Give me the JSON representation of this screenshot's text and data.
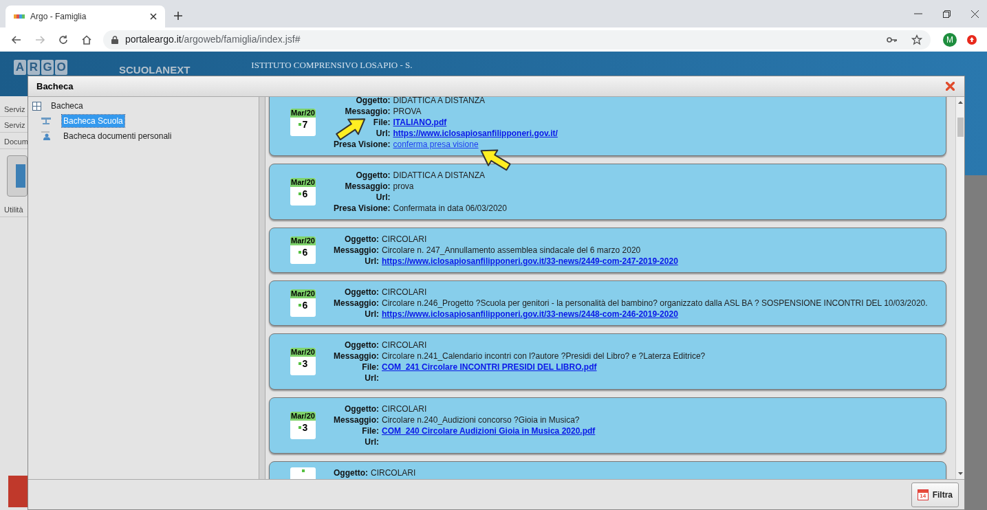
{
  "browser": {
    "tab_title": "Argo - Famiglia",
    "url_host": "portaleargo.it",
    "url_path": "/argoweb/famiglia/index.jsf#",
    "avatar": "M"
  },
  "app_header": {
    "logo_letters": [
      "A",
      "R",
      "G",
      "O"
    ],
    "product": "SCUOLANEXT",
    "school": "ISTITUTO COMPRENSIVO LOSAPIO - S."
  },
  "app_sidebar": {
    "items": [
      "Serviz",
      "Serviz",
      "Docum",
      "Utilità"
    ]
  },
  "dialog": {
    "title": "Bacheca",
    "tree": {
      "label": "Bacheca",
      "children": [
        {
          "label": "Bacheca Scuola",
          "selected": true
        },
        {
          "label": "Bacheca documenti personali",
          "selected": false
        }
      ]
    },
    "notices": [
      {
        "month": "Mar/20",
        "day": "7",
        "fields": [
          {
            "label": "Oggetto:",
            "value": "DIDATTICA A DISTANZA",
            "kind": "text"
          },
          {
            "label": "Messaggio:",
            "value": "PROVA",
            "kind": "text"
          },
          {
            "label": "File:",
            "value": "ITALIANO.pdf",
            "kind": "link"
          },
          {
            "label": "Url:",
            "value": "https://www.iclosapiosanfilipponeri.gov.it/",
            "kind": "link"
          },
          {
            "label": "Presa Visione:",
            "value": "conferma presa visione",
            "kind": "action"
          }
        ]
      },
      {
        "month": "Mar/20",
        "day": "6",
        "fields": [
          {
            "label": "Oggetto:",
            "value": "DIDATTICA A DISTANZA",
            "kind": "text"
          },
          {
            "label": "Messaggio:",
            "value": "prova",
            "kind": "text"
          },
          {
            "label": "Url:"
          },
          {
            "label": "Presa Visione:",
            "value": "Confermata in data 06/03/2020",
            "kind": "text"
          }
        ]
      },
      {
        "month": "Mar/20",
        "day": "6",
        "fields": [
          {
            "label": "Oggetto:",
            "value": "CIRCOLARI",
            "kind": "text"
          },
          {
            "label": "Messaggio:",
            "value": "Circolare n. 247_Annullamento assemblea sindacale del 6 marzo 2020",
            "kind": "text"
          },
          {
            "label": "Url:",
            "value": "https://www.iclosapiosanfilipponeri.gov.it/33-news/2449-com-247-2019-2020",
            "kind": "link"
          }
        ]
      },
      {
        "month": "Mar/20",
        "day": "6",
        "fields": [
          {
            "label": "Oggetto:",
            "value": "CIRCOLARI",
            "kind": "text"
          },
          {
            "label": "Messaggio:",
            "value": "Circolare n.246_Progetto ?Scuola per genitori - la personalità del bambino? organizzato dalla ASL BA ? SOSPENSIONE INCONTRI DEL 10/03/2020.",
            "kind": "text"
          },
          {
            "label": "Url:",
            "value": "https://www.iclosapiosanfilipponeri.gov.it/33-news/2448-com-246-2019-2020",
            "kind": "link"
          }
        ]
      },
      {
        "month": "Mar/20",
        "day": "3",
        "fields": [
          {
            "label": "Oggetto:",
            "value": "CIRCOLARI",
            "kind": "text"
          },
          {
            "label": "Messaggio:",
            "value": "Circolare n.241_Calendario incontri con l?autore ?Presidi del Libro? e ?Laterza Editrice?",
            "kind": "text"
          },
          {
            "label": "File:",
            "value": "COM_241 Circolare INCONTRI PRESIDI DEL LIBRO.pdf",
            "kind": "link"
          },
          {
            "label": "Url:"
          }
        ]
      },
      {
        "month": "Mar/20",
        "day": "3",
        "fields": [
          {
            "label": "Oggetto:",
            "value": "CIRCOLARI",
            "kind": "text"
          },
          {
            "label": "Messaggio:",
            "value": "Circolare n.240_Audizioni concorso ?Gioia in Musica?",
            "kind": "text"
          },
          {
            "label": "File:",
            "value": "COM_240 Circolare Audizioni Gioia in Musica 2020.pdf",
            "kind": "link"
          },
          {
            "label": "Url:"
          }
        ]
      },
      {
        "fields": [
          {
            "label": "Oggetto:",
            "value": "CIRCOLARI",
            "kind": "text"
          }
        ]
      }
    ],
    "filter_button": {
      "icon_day": "14",
      "label": "Filtra"
    }
  }
}
